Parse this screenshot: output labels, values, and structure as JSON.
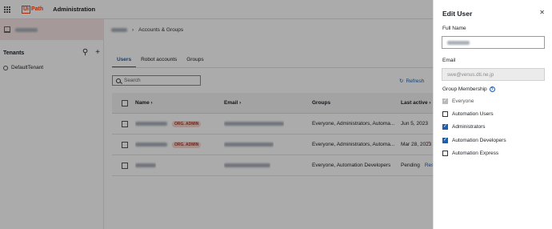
{
  "header": {
    "logo_box": "Ui",
    "logo_text": "Path",
    "title": "Administration"
  },
  "sidebar": {
    "tenants_label": "Tenants",
    "search_icon": "search-icon",
    "add_icon": "plus-icon",
    "tenant_item": "DefaultTenant"
  },
  "main": {
    "breadcrumb_current": "Accounts & Groups",
    "tabs": [
      {
        "label": "Users",
        "active": true
      },
      {
        "label": "Robot accounts"
      },
      {
        "label": "Groups"
      }
    ],
    "search_placeholder": "Search",
    "refresh_label": "Refresh",
    "table": {
      "headers": {
        "name": "Name",
        "email": "Email",
        "groups": "Groups",
        "last_active": "Last active"
      },
      "rows": [
        {
          "badge": "ORG. ADMIN",
          "groups": "Everyone, Administrators, Automa...",
          "last_active": "Jun 5, 2023"
        },
        {
          "badge": "ORG. ADMIN",
          "groups": "Everyone, Administrators, Automa...",
          "last_active": "Mar 28, 2023"
        },
        {
          "badge": "",
          "groups": "Everyone, Automation Developers",
          "last_active": "Pending",
          "action": "Resend"
        }
      ]
    }
  },
  "drawer": {
    "title": "Edit User",
    "close_icon": "close-icon",
    "full_name_label": "Full Name",
    "email_label": "Email",
    "email_value": "swe@venus.dti.ne.jp",
    "group_membership_label": "Group Membership",
    "groups": [
      {
        "label": "Everyone",
        "checked": true,
        "disabled": true
      },
      {
        "label": "Automation Users",
        "checked": false
      },
      {
        "label": "Administrators",
        "checked": true
      },
      {
        "label": "Automation Developers",
        "checked": true
      },
      {
        "label": "Automation Express",
        "checked": false
      }
    ]
  },
  "annotation": {
    "arrow": "→",
    "arrow_color": "#d0021b"
  },
  "colors": {
    "accent": "#1f5ea8",
    "brand": "#fa4616"
  }
}
